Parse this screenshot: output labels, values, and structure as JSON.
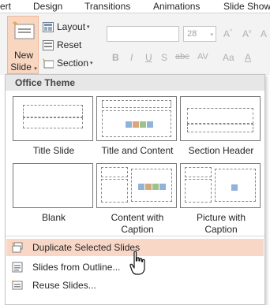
{
  "ribbon_tabs": [
    "ert",
    "Design",
    "Transitions",
    "Animations",
    "Slide Show"
  ],
  "new_slide": {
    "line1": "New",
    "line2": "Slide",
    "caret": "▾"
  },
  "slides_group": {
    "layout": "Layout",
    "reset": "Reset",
    "section": "Section"
  },
  "font": {
    "name": "",
    "size": "28"
  },
  "format_glyphs": [
    "B",
    "I",
    "U",
    "S",
    "abc",
    "AV",
    "Aa"
  ],
  "menu": {
    "theme_header": "Office Theme",
    "layouts": [
      {
        "label": "Title Slide"
      },
      {
        "label": "Title and Content"
      },
      {
        "label": "Section Header"
      },
      {
        "label": "Blank"
      },
      {
        "label": "Content with Caption"
      },
      {
        "label": "Picture with Caption"
      }
    ],
    "commands": {
      "duplicate": "Duplicate Selected Slides",
      "outline": "Slides from Outline...",
      "reuse": "Reuse Slides..."
    }
  },
  "colors": {
    "accent_orange": "#f8d6c0",
    "highlight": "#f9d7c7",
    "border": "#7a7a7a"
  },
  "icons": [
    "new-slide-icon",
    "layout-icon",
    "reset-icon",
    "section-icon",
    "duplicate-slide-icon",
    "outline-icon",
    "reuse-slides-icon",
    "hand-pointer-cursor-icon"
  ]
}
